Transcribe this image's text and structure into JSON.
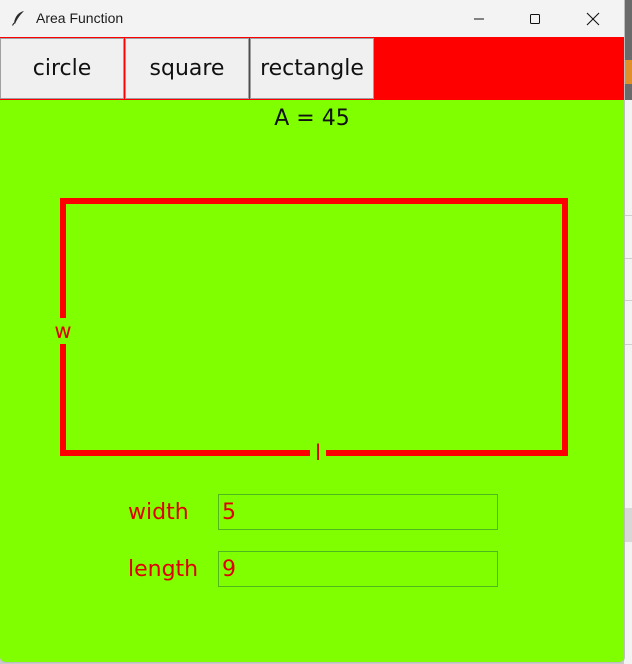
{
  "window": {
    "title": "Area Function"
  },
  "colors": {
    "background": "#7fff00",
    "accent": "#ff0000",
    "button_face": "#f0f0f0"
  },
  "toolbar": {
    "buttons": [
      {
        "label": "circle"
      },
      {
        "label": "square"
      },
      {
        "label": "rectangle"
      }
    ]
  },
  "result": {
    "text": "A = 45"
  },
  "shape": {
    "type": "rectangle",
    "width_marker": "w",
    "length_marker": "l"
  },
  "form": {
    "width_label": "width",
    "width_value": "5",
    "length_label": "length",
    "length_value": "9"
  },
  "icons": {
    "app": "feather-icon",
    "minimize": "minimize-icon",
    "maximize": "maximize-icon",
    "close": "close-icon"
  }
}
